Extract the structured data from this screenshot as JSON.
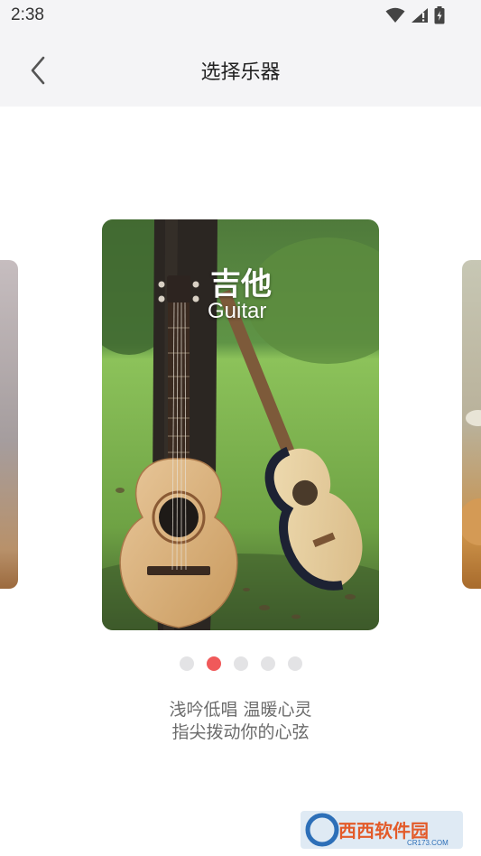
{
  "status_bar": {
    "time": "2:38",
    "icons": [
      "wifi-icon",
      "cell-signal-icon",
      "battery-icon"
    ]
  },
  "header": {
    "title": "选择乐器",
    "back_icon": "chevron-left-icon"
  },
  "carousel": {
    "active_index": 1,
    "total": 5,
    "active_card": {
      "name_zh": "吉他",
      "name_en": "Guitar"
    }
  },
  "description": {
    "line1": "浅吟低唱 温暖心灵",
    "line2": "指尖拨动你的心弦"
  },
  "watermark": {
    "text": "西西软件园",
    "sub": "CR173.COM"
  },
  "colors": {
    "accent": "#f0595a",
    "dot_inactive": "#e3e3e5",
    "header_bg": "#f4f4f6"
  }
}
